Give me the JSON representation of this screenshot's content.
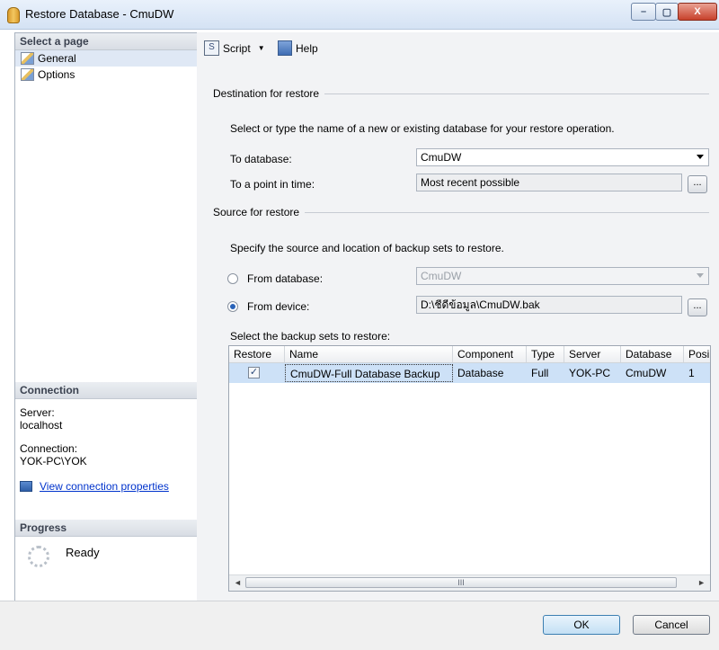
{
  "window": {
    "title": "Restore Database - CmuDW",
    "minimize": "–",
    "maximize": "▢",
    "close": "X"
  },
  "sidebar": {
    "select_page_header": "Select a page",
    "pages": [
      {
        "label": "General",
        "selected": true
      },
      {
        "label": "Options",
        "selected": false
      }
    ],
    "connection_header": "Connection",
    "server_label": "Server:",
    "server_value": "localhost",
    "connection_label": "Connection:",
    "connection_value": "YOK-PC\\YOK",
    "view_connection_link": "View connection properties",
    "progress_header": "Progress",
    "progress_status": "Ready"
  },
  "toolbar": {
    "script_label": "Script",
    "help_label": "Help"
  },
  "destination": {
    "header": "Destination for restore",
    "instruction": "Select or type the name of a new or existing database for your restore operation.",
    "to_database_label": "To database:",
    "to_database_value": "CmuDW",
    "point_in_time_label": "To a point in time:",
    "point_in_time_value": "Most recent possible",
    "browse_label": "..."
  },
  "source": {
    "header": "Source for restore",
    "instruction": "Specify the source and location of backup sets to restore.",
    "from_database_label": "From database:",
    "from_database_value": "CmuDW",
    "from_database_selected": false,
    "from_device_label": "From device:",
    "from_device_value": "D:\\ชีดีข้อมูล\\CmuDW.bak",
    "from_device_selected": true,
    "browse_label": "...",
    "backup_sets_label": "Select the backup sets to restore:"
  },
  "backup_grid": {
    "columns": [
      "Restore",
      "Name",
      "Component",
      "Type",
      "Server",
      "Database",
      "Posi"
    ],
    "rows": [
      {
        "restore": "✓",
        "name": "CmuDW-Full Database Backup",
        "component": "Database",
        "type": "Full",
        "server": "YOK-PC",
        "database": "CmuDW",
        "position": "1"
      }
    ],
    "scroll_left": "◄",
    "scroll_thumb": "III",
    "scroll_right": "►"
  },
  "buttons": {
    "ok": "OK",
    "cancel": "Cancel"
  },
  "colors": {
    "accent": "#0033cc",
    "selection": "#cde1f7",
    "panel_bg": "#f2f3f5"
  }
}
